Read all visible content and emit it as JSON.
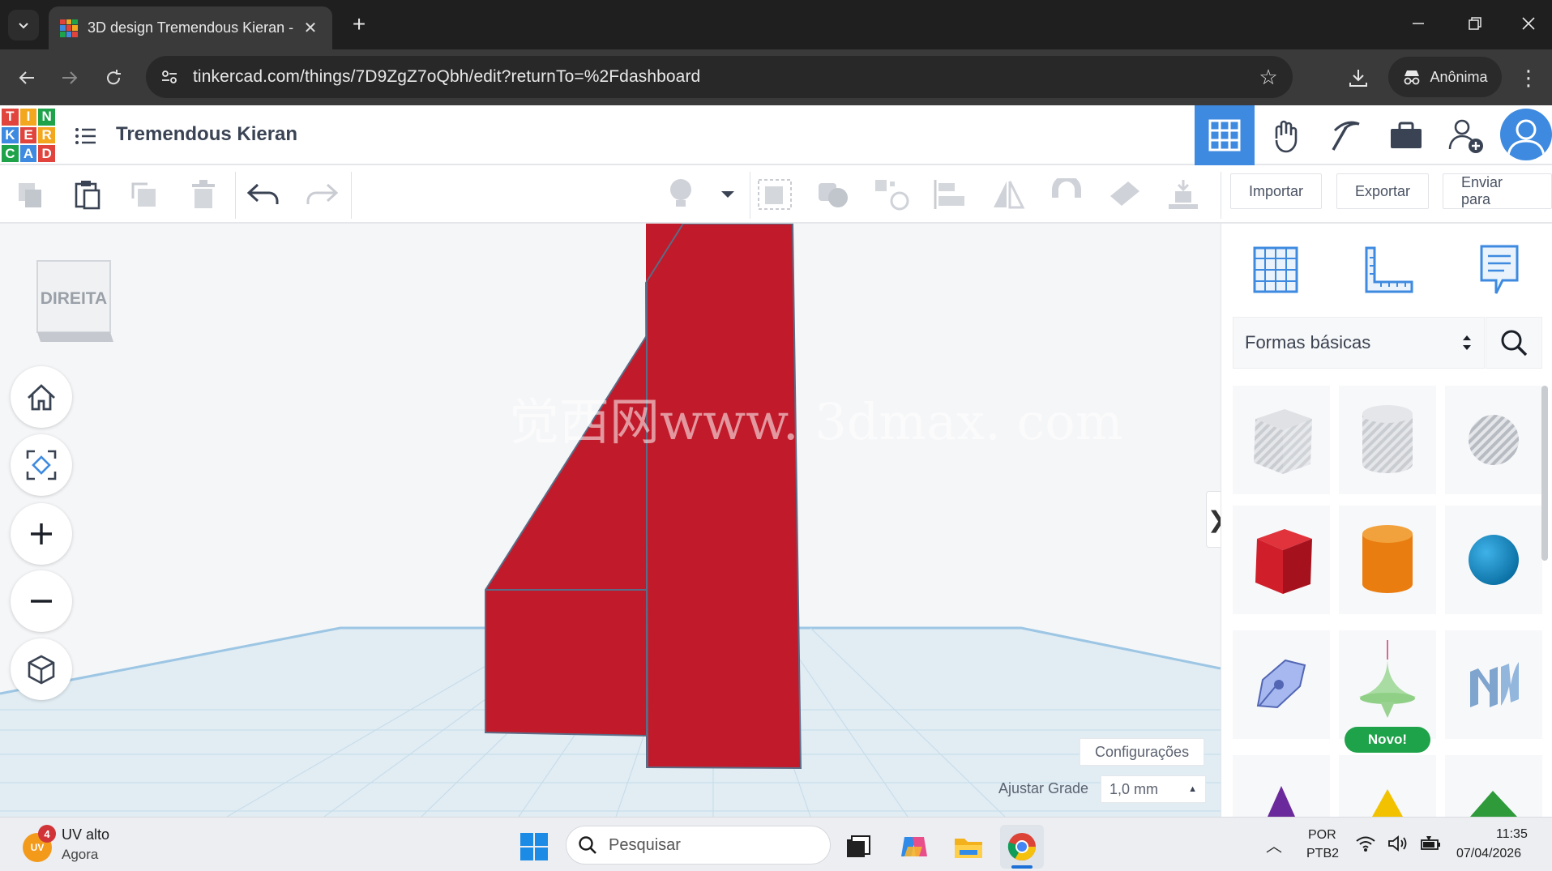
{
  "browser": {
    "tab_title": "3D design Tremendous Kieran -",
    "url": "tinkercad.com/things/7D9ZgZ7oQbh/edit?returnTo=%2Fdashboard",
    "profile_label": "Anônima"
  },
  "app": {
    "logo_letters": [
      "T",
      "I",
      "N",
      "K",
      "E",
      "R",
      "C",
      "A",
      "D"
    ],
    "design_title": "Tremendous Kieran",
    "toolbar": {
      "import_label": "Importar",
      "export_label": "Exportar",
      "send_label": "Enviar para"
    },
    "viewcube_label": "DIREITA",
    "workplane": {
      "watermark": "觉西网www. 3dmax. com",
      "settings_label": "Configurações",
      "snap_label": "Ajustar Grade",
      "snap_value": "1,0 mm"
    },
    "shapes_panel": {
      "category": "Formas básicas",
      "new_badge": "Novo!",
      "shapes": [
        "box-hole",
        "cylinder-hole",
        "sphere-hole",
        "box",
        "cylinder",
        "sphere",
        "scribble",
        "cone-top",
        "text",
        "pyramid",
        "roof",
        "wedge"
      ]
    }
  },
  "taskbar": {
    "weather_badge": "4",
    "weather_icon_text": "UV",
    "weather_title": "UV alto",
    "weather_sub": "Agora",
    "search_placeholder": "Pesquisar",
    "lang_top": "POR",
    "lang_bottom": "PTB2",
    "time": "11:35",
    "date": "07/04/2026"
  },
  "colors": {
    "accent": "#3d8ae0",
    "shape_red": "#c11a2a",
    "badge_green": "#1ea24a"
  }
}
